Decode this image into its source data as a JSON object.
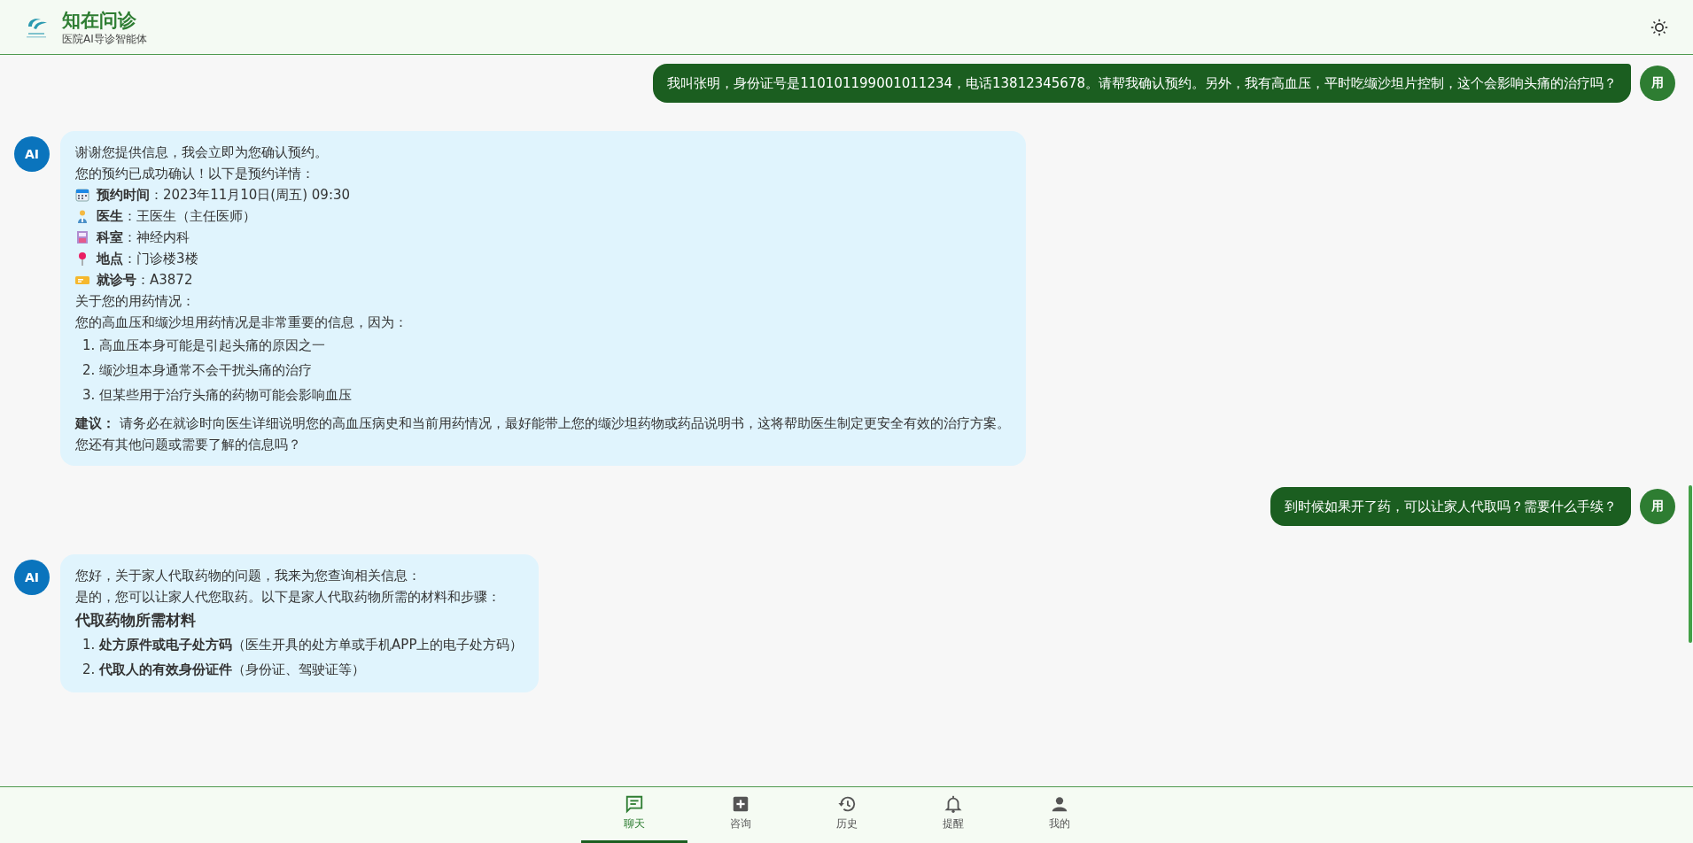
{
  "header": {
    "title": "知在问诊",
    "subtitle": "医院AI导诊智能体"
  },
  "messages": [
    {
      "kind": "user",
      "avatar": "用",
      "text": "我叫张明，身份证号是110101199001011234，电话13812345678。请帮我确认预约。另外，我有高血压，平时吃缬沙坦片控制，这个会影响头痛的治疗吗？"
    },
    {
      "kind": "ai",
      "avatar": "AI",
      "blocks": [
        {
          "kind": "p",
          "text": "谢谢您提供信息，我会立即为您确认预约。"
        },
        {
          "kind": "p",
          "text": "您的预约已成功确认！以下是预约详情："
        },
        {
          "kind": "calendar",
          "text": "**预约时间**：2023年11月10日(周五) 09:30"
        },
        {
          "kind": "doctor",
          "text": "**医生**：王医生（主任医师）"
        },
        {
          "kind": "clinic",
          "text": "**科室**：神经内科"
        },
        {
          "kind": "pin",
          "text": "**地点**：门诊楼3楼"
        },
        {
          "kind": "ticket",
          "text": "**就诊号**：A3872"
        },
        {
          "kind": "p",
          "text": "关于您的用药情况："
        },
        {
          "kind": "p",
          "text": "您的高血压和缬沙坦用药情况是非常重要的信息，因为："
        },
        {
          "kind": "item",
          "text": "1. 高血压本身可能是引起头痛的原因之一"
        },
        {
          "kind": "item",
          "text": "2. 缬沙坦本身通常不会干扰头痛的治疗"
        },
        {
          "kind": "item",
          "text": "3. 但某些用于治疗头痛的药物可能会影响血压"
        },
        {
          "kind": "note",
          "text": "**建议：**  请务必在就诊时向医生详细说明您的高血压病史和当前用药情况，最好能带上您的缬沙坦药物或药品说明书，这将帮助医生制定更安全有效的治疗方案。"
        },
        {
          "kind": "p",
          "text": "您还有其他问题或需要了解的信息吗？"
        }
      ]
    },
    {
      "kind": "user",
      "avatar": "用",
      "text": "到时候如果开了药，可以让家人代取吗？需要什么手续？"
    },
    {
      "kind": "ai",
      "avatar": "AI",
      "blocks": [
        {
          "kind": "p",
          "text": "您好，关于家人代取药物的问题，我来为您查询相关信息："
        },
        {
          "kind": "p",
          "text": "是的，您可以让家人代您取药。以下是家人代取药物所需的材料和步骤："
        },
        {
          "kind": "heading",
          "text": "代取药物所需材料"
        },
        {
          "kind": "item",
          "text": "1. **处方原件或电子处方码**（医生开具的处方单或手机APP上的电子处方码）"
        },
        {
          "kind": "item",
          "text": "2. **代取人的有效身份证件**（身份证、驾驶证等）"
        }
      ]
    }
  ],
  "nav": [
    {
      "label": "聊天",
      "selected": true
    },
    {
      "label": "咨询",
      "selected": false
    },
    {
      "label": "历史",
      "selected": false
    },
    {
      "label": "提醒",
      "selected": false
    },
    {
      "label": "我的",
      "selected": false
    }
  ]
}
